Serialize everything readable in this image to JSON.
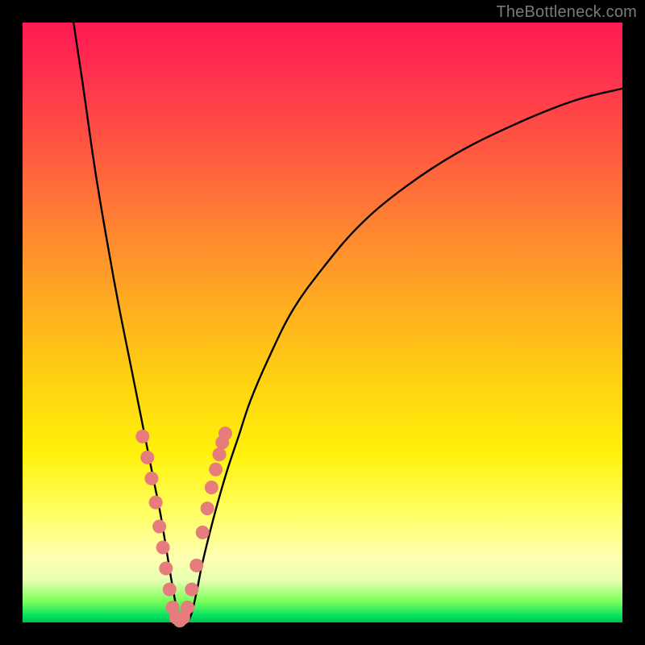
{
  "watermark": {
    "text": "TheBottleneck.com"
  },
  "colors": {
    "frame": "#000000",
    "curve_stroke": "#000000",
    "marker_fill": "#e77c7d",
    "marker_stroke": "#c25e60"
  },
  "chart_data": {
    "type": "line",
    "title": "",
    "xlabel": "",
    "ylabel": "",
    "xlim": [
      0,
      100
    ],
    "ylim": [
      0,
      100
    ],
    "grid": false,
    "legend": false,
    "note": "Axes have no tick labels; x/y values estimated from pixel positions on a 0–100 scale. Curve is a V-shaped profile: steep descent from top-left to a zero-minimum near x≈24–27, then a slower concave rise toward the top-right. Pink markers cluster on both flanks near the valley.",
    "series": [
      {
        "name": "curve",
        "kind": "line",
        "x": [
          8.5,
          10,
          12,
          14,
          16,
          18,
          20,
          21,
          22,
          23,
          24,
          25,
          26,
          27,
          28,
          29,
          30,
          32,
          34,
          36,
          38,
          41,
          45,
          50,
          56,
          63,
          72,
          82,
          92,
          100
        ],
        "y": [
          100,
          90,
          76,
          64,
          53,
          43,
          33,
          28,
          23,
          18,
          12,
          6,
          1,
          0,
          1,
          5,
          10,
          18,
          25,
          31,
          37,
          44,
          52,
          59,
          66,
          72,
          78,
          83,
          87,
          89
        ]
      },
      {
        "name": "markers",
        "kind": "scatter",
        "x": [
          20.0,
          20.8,
          21.5,
          22.2,
          22.8,
          23.4,
          23.9,
          24.5,
          25.0,
          25.6,
          26.2,
          26.8,
          27.5,
          28.2,
          29.0,
          30.0,
          30.8,
          31.5,
          32.2,
          32.8,
          33.3,
          33.8
        ],
        "y": [
          31.0,
          27.5,
          24.0,
          20.0,
          16.0,
          12.5,
          9.0,
          5.5,
          2.5,
          0.8,
          0.3,
          0.8,
          2.5,
          5.5,
          9.5,
          15.0,
          19.0,
          22.5,
          25.5,
          28.0,
          30.0,
          31.5
        ]
      }
    ]
  }
}
